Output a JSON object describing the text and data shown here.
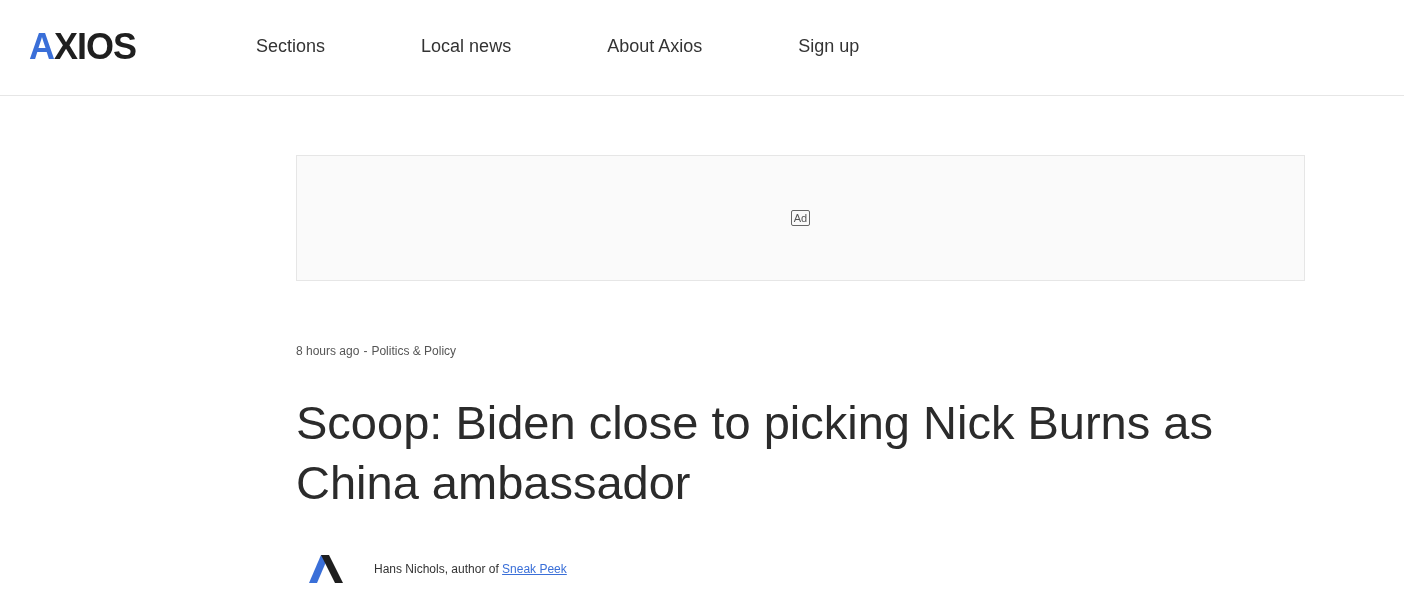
{
  "header": {
    "logo": "AXIOS",
    "nav": [
      "Sections",
      "Local news",
      "About Axios",
      "Sign up"
    ]
  },
  "ad": {
    "label": "Ad"
  },
  "article": {
    "time": "8 hours ago",
    "separator": "-",
    "section": "Politics & Policy",
    "title": "Scoop: Biden close to picking Nick Burns as China ambassador",
    "byline": "Hans Nichols, author of",
    "newsletter": "Sneak Peek"
  }
}
